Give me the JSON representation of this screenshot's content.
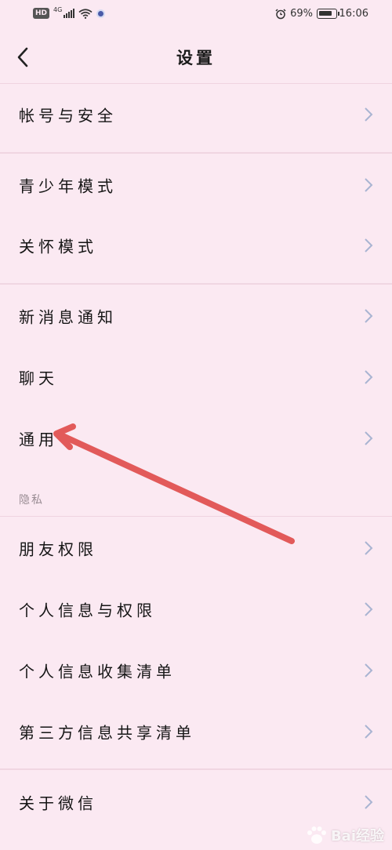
{
  "status_bar": {
    "hd": "HD",
    "network": "4G",
    "battery_percent": "69%",
    "time": "16:06",
    "icons": [
      "signal-icon",
      "wifi-icon",
      "app-notification-icon",
      "alarm-icon",
      "battery-icon"
    ]
  },
  "nav": {
    "title": "设置",
    "back_icon": "chevron-left-icon"
  },
  "menu": {
    "account": "帐号与安全",
    "youth_mode": "青少年模式",
    "care_mode": "关怀模式",
    "notifications": "新消息通知",
    "chat": "聊天",
    "general": "通用",
    "privacy_header": "隐私",
    "friend_permissions": "朋友权限",
    "personal_info_permissions": "个人信息与权限",
    "personal_info_list": "个人信息收集清单",
    "third_party_list": "第三方信息共享清单",
    "about": "关于微信"
  },
  "annotation": {
    "arrow_color": "#e25a5a",
    "points_to": "general"
  },
  "watermark": {
    "text": "Bai经验"
  },
  "colors": {
    "background": "#fbe9f2",
    "divider": "#efd4e0",
    "chevron": "#a9b4d2"
  }
}
